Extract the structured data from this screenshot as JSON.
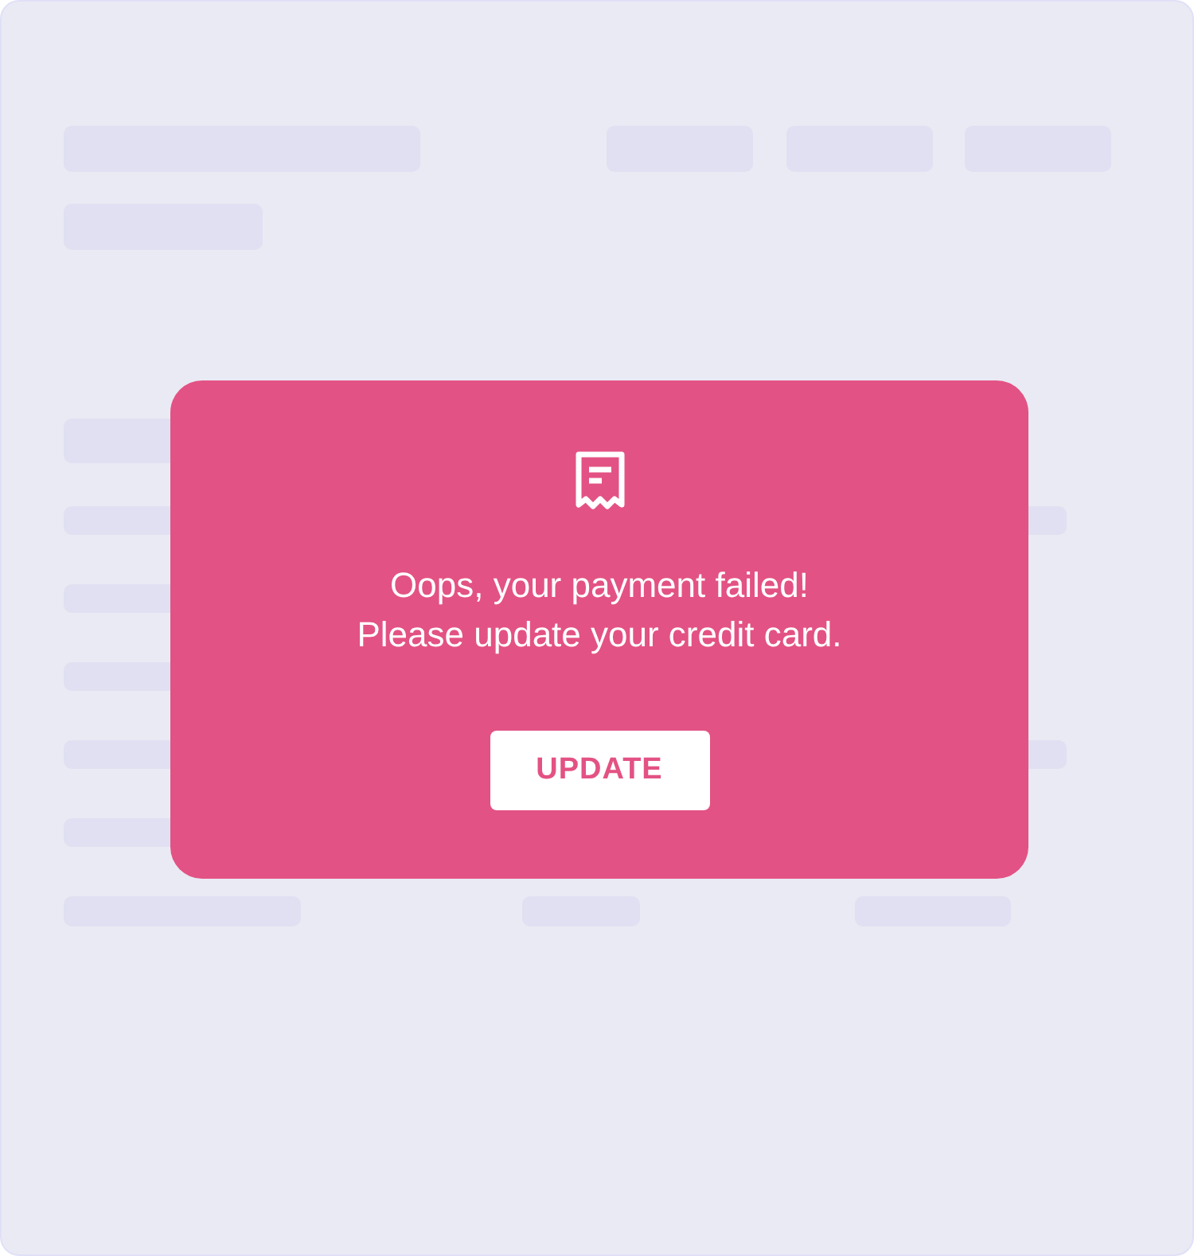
{
  "dialog": {
    "message_lines": [
      "Oops, your payment failed!",
      "Please update your credit card."
    ],
    "button": "UPDATE"
  }
}
